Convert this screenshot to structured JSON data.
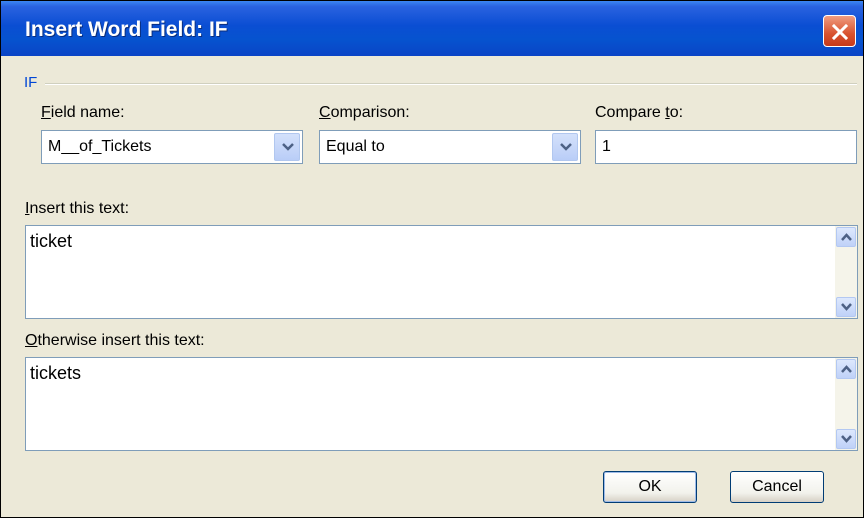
{
  "dialog": {
    "title": "Insert Word Field: IF",
    "group_label": "IF"
  },
  "fields": {
    "field_name": {
      "label_first": "F",
      "label_rest": "ield name:",
      "value": "M__of_Tickets"
    },
    "comparison": {
      "label_first": "C",
      "label_rest": "omparison:",
      "value": "Equal to"
    },
    "compare_to": {
      "label_pre": "Compare ",
      "label_key": "t",
      "label_post": "o:",
      "value": "1"
    }
  },
  "insert_text": {
    "label_first": "I",
    "label_rest": "nsert this text:",
    "value": "ticket"
  },
  "otherwise_text": {
    "label_first": "O",
    "label_rest": "therwise insert this text:",
    "value": "tickets"
  },
  "buttons": {
    "ok": "OK",
    "cancel": "Cancel"
  },
  "icons": {
    "close": "close-icon",
    "dropdown": "chevron-down-icon",
    "scroll_up": "arrow-up-icon",
    "scroll_down": "arrow-down-icon"
  },
  "colors": {
    "titlebar": "#0a4ed3",
    "close": "#d8522f",
    "dialog_bg": "#ece9d8",
    "group_label": "#0046d5"
  }
}
